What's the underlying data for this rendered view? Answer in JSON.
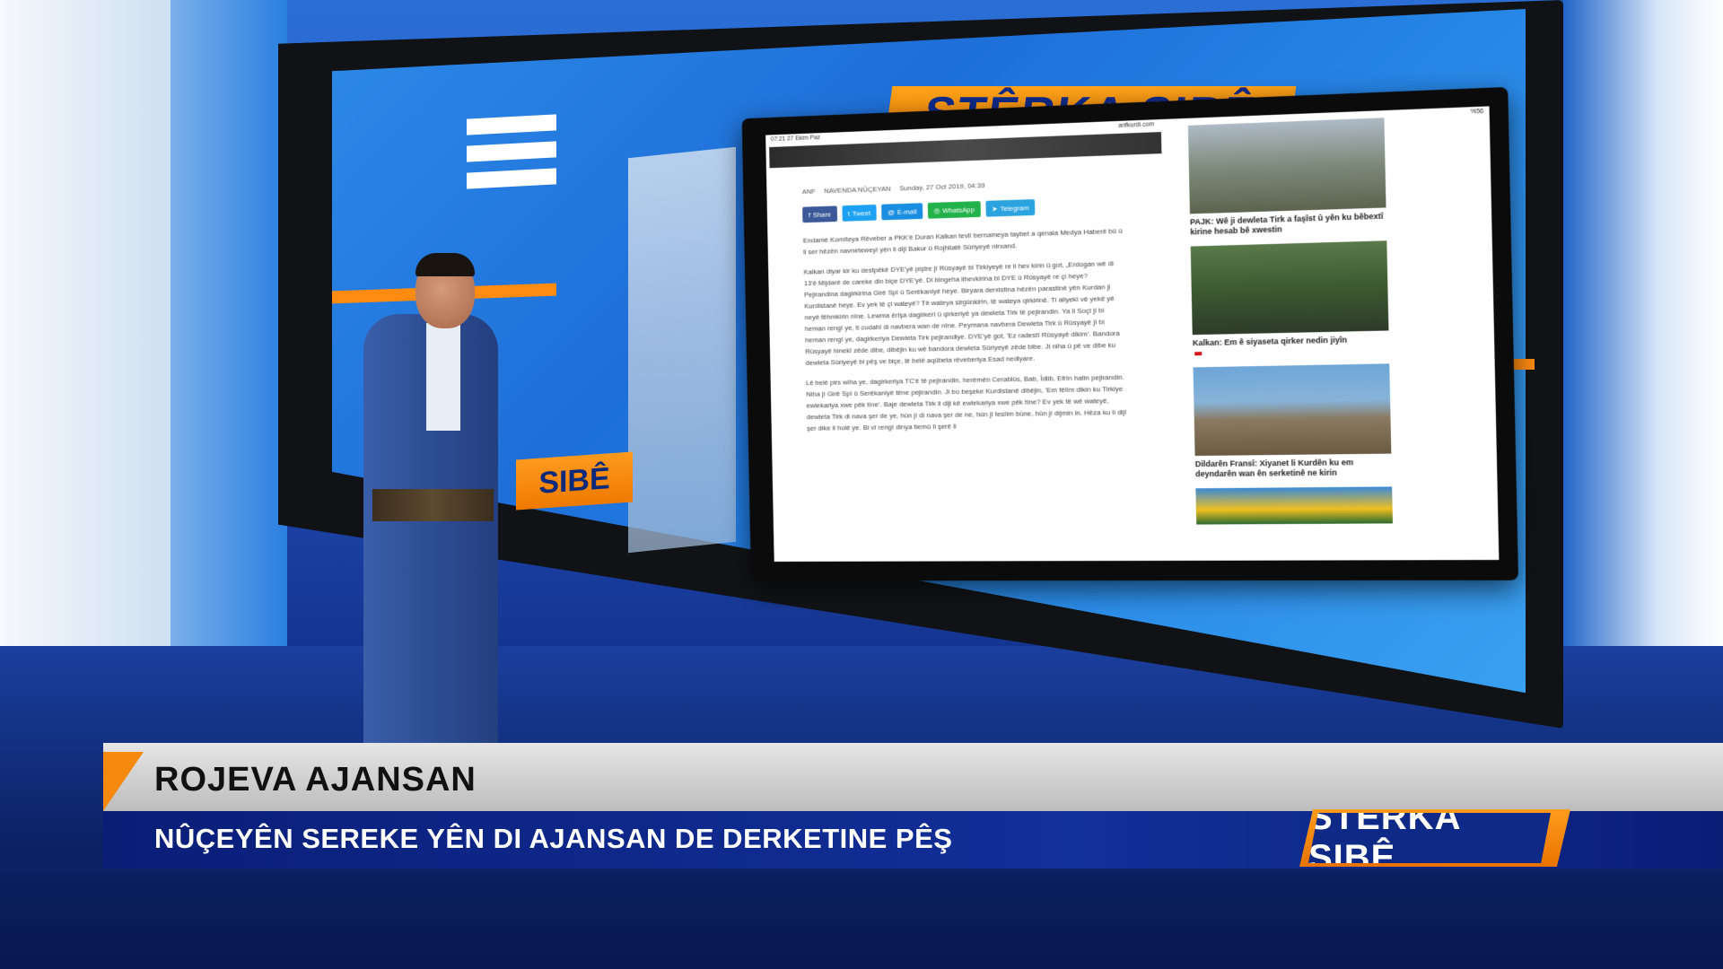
{
  "studio": {
    "wall_logo": "STÊRKA SIBÊ",
    "wall_tag": "SIBÊ"
  },
  "tablet": {
    "status_time": "07:21  27 Ekim Paz",
    "status_url": "anfkurdi.com",
    "status_battery": "%56",
    "byline": {
      "author": "ANF",
      "desk": "NAVENDA NÛÇEYAN",
      "date": "Sunday, 27 Oct 2019, 04:39"
    },
    "share_buttons": [
      "Share",
      "Tweet",
      "E-mail",
      "WhatsApp",
      "Telegram"
    ],
    "paragraphs": [
      "Endamê Komîteya Rêveber a PKK'ê Duran Kalkan tevlî bernameya taybet a qenala Medya Haberê bû û li ser hêzên navneteweyî yên li dijî Bakur û Rojhilatê Sûriyeyê nirxand.",
      "Kalkan diyar kir ku destpêkê DYE'yê piştre jî Rûsyayê bi Tirkiyeyê re li hev kirin û got, „Erdogan wê di 13'ê Mijdarê de careke din biçe DYE'yê. Di bingeha lihevkirina bi DYE û Rûsyayê re çi heye? Pejirandina dagirkirina Girê Spî û Serêkaniyê heye. Biryara derxistina hêzên parastinê yên Kurdan ji Kurdistanê heye. Ev yek tê çi wateyê? Tê wateya sirgûnkirin, tê wateya qirkirinê. Ti aliyekî vê yekê yê neyê fêhmkirin nîne. Lewma êrîşa dagirkerî û qirkeriyê ya dewleta Tirk tê pejirandin. Ya li Soçî jî bi heman rengî ye, ti cudahî di navbera wan de nîne. Peymana navbera Dewleta Tirk û Rûsyayê jî bi heman rengî ye, dagirkeriya Dewleta Tirk pejirandiye. DYE'yê got, 'Ez radestî Rûsyayê dikim'. Bandora Rûsyayê hinekî zêde dibe, dibêjin ku wê bandora dewleta Sûriyeyê zêde bibe. Ji niha û pê ve dibe ku dewleta Sûriyeyê bi pêş ve biçe, lê belê aqûbeta rêveberiya Esad nediyare.",
      "Lê belê pirs wiha ye, dagirkeriya TC'ê tê pejirandin, herêmên Cerablûs, Bab, Îdlib, Efrîn hatin pejirandin. Niha jî Girê Spî û Serêkaniyê têne pejirandin. Ji bo beşeke Kurdistanê dibêjin, 'Em fêlîm dikin ku Tirkiye ewlekariya xwe pêk tîne'. Baje dewleta Tirk li diji kê ewlekariya xwe pêk tîne? Ev yek tê wê wateyê, dewleta Tirk di nava şer de ye, hûn jî di nava şer de ne, hûn jî teslîm bûne, hûn jî dijmin in. Hêza ku li dijî şer dike li holê ye. Bi vî rengî dinya tiemû li şerê li"
    ],
    "sidebar": [
      {
        "caption": "PAJK: Wê ji dewleta Tirk a faşîst û yên ku bêbextî kirine hesab bê xwestin"
      },
      {
        "caption": "Kalkan: Em ê siyaseta qirker nedin jiyîn"
      },
      {
        "caption": "Dildarên Fransî: Xiyanet li Kurdên ku em deyndarên wan ên serketinê ne kirin"
      }
    ]
  },
  "lower_third": {
    "title": "ROJEVA AJANSAN",
    "subtitle": "NÛÇEYÊN SEREKE YÊN DI AJANSAN DE DERKETINE PÊŞ",
    "logo": "STÊRKA SIBÊ"
  },
  "colors": {
    "brand_orange": "#f58a0f",
    "brand_blue": "#0e2a86",
    "studio_blue": "#1f6fd8"
  }
}
